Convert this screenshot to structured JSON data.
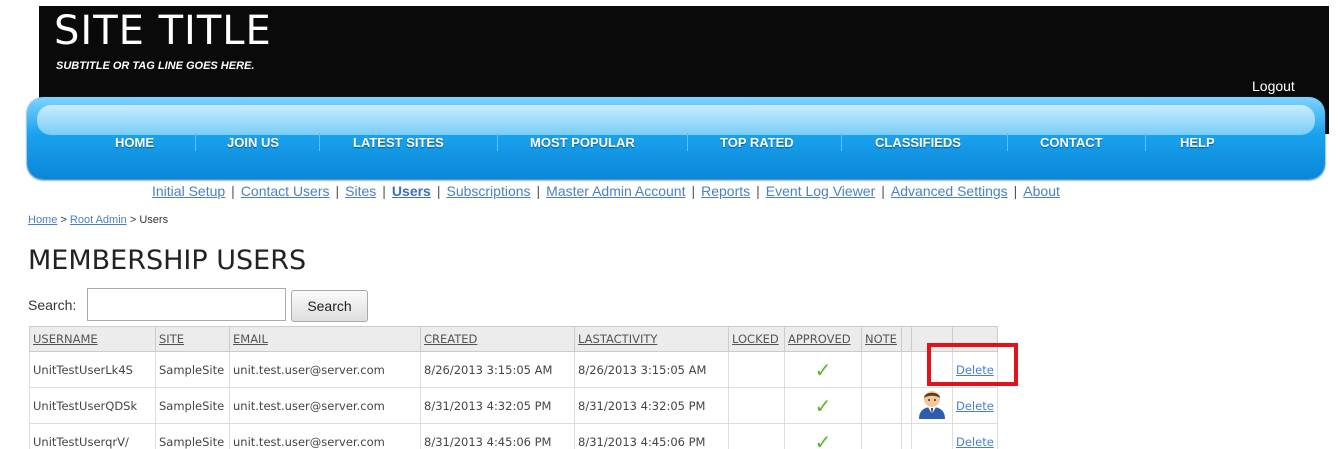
{
  "header": {
    "title": "SITE TITLE",
    "subtitle": "SUBTITLE OR TAG LINE GOES HERE.",
    "logout_label": "Logout"
  },
  "nav": {
    "items": [
      {
        "label": "HOME"
      },
      {
        "label": "JOIN US"
      },
      {
        "label": "LATEST SITES"
      },
      {
        "label": "MOST POPULAR"
      },
      {
        "label": "TOP RATED"
      },
      {
        "label": "CLASSIFIEDS"
      },
      {
        "label": "CONTACT"
      },
      {
        "label": "HELP"
      }
    ]
  },
  "admin_links": {
    "separator": "|",
    "items": [
      {
        "label": "Initial Setup"
      },
      {
        "label": "Contact Users"
      },
      {
        "label": "Sites"
      },
      {
        "label": "Users"
      },
      {
        "label": "Subscriptions"
      },
      {
        "label": "Master Admin Account"
      },
      {
        "label": "Reports"
      },
      {
        "label": "Event Log Viewer"
      },
      {
        "label": "Advanced Settings"
      },
      {
        "label": "About"
      }
    ]
  },
  "breadcrumb": {
    "items": [
      {
        "label": "Home"
      },
      {
        "label": "Root Admin"
      },
      {
        "label": "Users"
      }
    ],
    "separator": ">"
  },
  "page": {
    "title": "MEMBERSHIP USERS"
  },
  "search": {
    "label": "Search:",
    "value": "",
    "button_label": "Search"
  },
  "table": {
    "columns": [
      "USERNAME",
      "SITE",
      "EMAIL",
      "CREATED",
      "LASTACTIVITY",
      "LOCKED",
      "APPROVED",
      "NOTE"
    ],
    "rows": [
      {
        "username": "UnitTestUserLk4S",
        "site": "SampleSite",
        "email": "unit.test.user@server.com",
        "created": "8/26/2013 3:15:05 AM",
        "lastactivity": "8/26/2013 3:15:05 AM",
        "locked": "",
        "approved": "✓",
        "note": "",
        "has_avatar": false,
        "action_label": "Delete"
      },
      {
        "username": "UnitTestUserQDSk",
        "site": "SampleSite",
        "email": "unit.test.user@server.com",
        "created": "8/31/2013 4:32:05 PM",
        "lastactivity": "8/31/2013 4:32:05 PM",
        "locked": "",
        "approved": "✓",
        "note": "",
        "has_avatar": true,
        "action_label": "Delete"
      },
      {
        "username": "UnitTestUserqrV/",
        "site": "SampleSite",
        "email": "unit.test.user@server.com",
        "created": "8/31/2013 4:45:06 PM",
        "lastactivity": "8/31/2013 4:45:06 PM",
        "locked": "",
        "approved": "✓",
        "note": "",
        "has_avatar": false,
        "action_label": "Delete"
      }
    ]
  },
  "colors": {
    "header_bg": "#0a0a0a",
    "nav_blue": "#1aa3ee",
    "link": "#4a80c8",
    "checkmark": "#5ab82e",
    "highlight": "#e4111b"
  }
}
